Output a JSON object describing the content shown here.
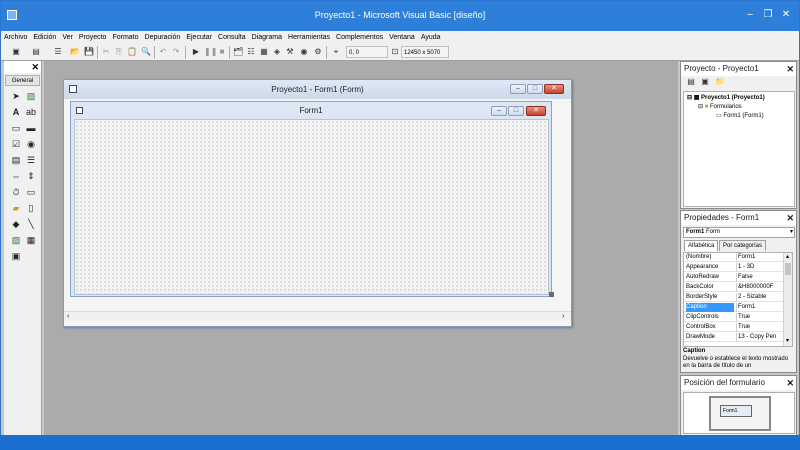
{
  "window": {
    "title": "Proyecto1 - Microsoft Visual Basic [diseño]"
  },
  "menu": [
    "Archivo",
    "Edición",
    "Ver",
    "Proyecto",
    "Formato",
    "Depuración",
    "Ejecutar",
    "Consulta",
    "Diagrama",
    "Herramientas",
    "Complementos",
    "Ventana",
    "Ayuda"
  ],
  "toolbar": {
    "position": "0, 0",
    "size": "12450 x 5070"
  },
  "toolbox": {
    "tab_label": "General"
  },
  "form_window": {
    "title": "Proyecto1 - Form1 (Form)",
    "form_caption": "Form1"
  },
  "project_explorer": {
    "title": "Proyecto - Proyecto1",
    "root": "Proyecto1 (Proyecto1)",
    "folder": "Formularios",
    "item": "Form1 (Form1)"
  },
  "properties": {
    "title": "Propiedades - Form1",
    "object_selector": "Form1",
    "object_type": "Form",
    "tab_alpha": "Alfabética",
    "tab_category": "Por categorías",
    "rows": [
      {
        "name": "(Nombre)",
        "value": "Form1"
      },
      {
        "name": "Appearance",
        "value": "1 - 3D"
      },
      {
        "name": "AutoRedraw",
        "value": "False"
      },
      {
        "name": "BackColor",
        "value": "&H8000000F"
      },
      {
        "name": "BorderStyle",
        "value": "2 - Sizable"
      },
      {
        "name": "Caption",
        "value": "Form1"
      },
      {
        "name": "ClipControls",
        "value": "True"
      },
      {
        "name": "ControlBox",
        "value": "True"
      },
      {
        "name": "DrawMode",
        "value": "13 - Copy Pen"
      }
    ],
    "selected_index": 5,
    "desc_title": "Caption",
    "desc_text": "Devuelve o establece el texto mostrado en la barra de título de un"
  },
  "form_layout": {
    "title": "Posición del formulario",
    "preview_label": "Form1"
  },
  "colors": {
    "titlebar": "#2d7fd9",
    "mdi_background": "#ababab",
    "selection": "#3399ff"
  }
}
